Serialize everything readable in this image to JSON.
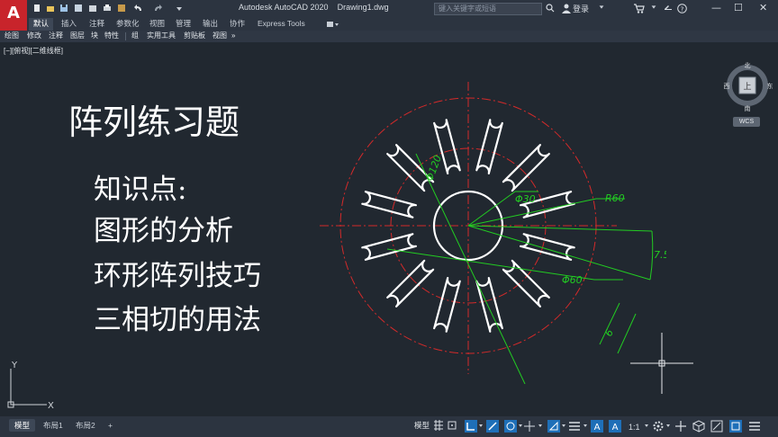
{
  "app": {
    "logo_letter": "A",
    "title": "Autodesk AutoCAD 2020    Drawing1.dwg",
    "search_placeholder": "键入关键字或短语",
    "login_label": "登录",
    "minimize_symbol": "—",
    "maximize_symbol": "☐",
    "close_symbol": "✕"
  },
  "ribbon_tabs": [
    "默认",
    "插入",
    "注释",
    "参数化",
    "视图",
    "管理",
    "输出",
    "协作",
    "Express Tools"
  ],
  "active_ribbon_tab": "默认",
  "menu_items": [
    "绘图",
    "修改",
    "注释",
    "图层",
    "块",
    "特性",
    "组",
    "实用工具",
    "剪贴板",
    "视图"
  ],
  "viewport": {
    "label": "[−][俯视][二维线框]"
  },
  "lesson": {
    "title": "阵列练习题",
    "lines": [
      "知识点:",
      "图形的分析",
      "环形阵列技巧",
      "三相切的用法"
    ]
  },
  "drawing": {
    "slot_count": 12,
    "dimensions": {
      "outer_diameter": "Φ120",
      "inner_diameter": "Φ30",
      "pitch_circle_diameter": "Φ60",
      "radius": "R60",
      "angle": "7.5°",
      "slot_width": "6"
    },
    "colors": {
      "geometry": "#ffffff",
      "centerline": "#d42a2a",
      "dimension": "#22cc22"
    }
  },
  "navigation": {
    "compass_north": "北",
    "compass_south": "南",
    "compass_east": "东",
    "compass_west": "西",
    "viewcube_face": "上",
    "wcs_label": "WCS"
  },
  "ucs": {
    "x_label": "X",
    "y_label": "Y"
  },
  "layout_tabs": [
    "模型",
    "布局1",
    "布局2"
  ],
  "add_tab_symbol": "+",
  "status_bar": {
    "model_label": "模型",
    "scale": "1:1"
  }
}
